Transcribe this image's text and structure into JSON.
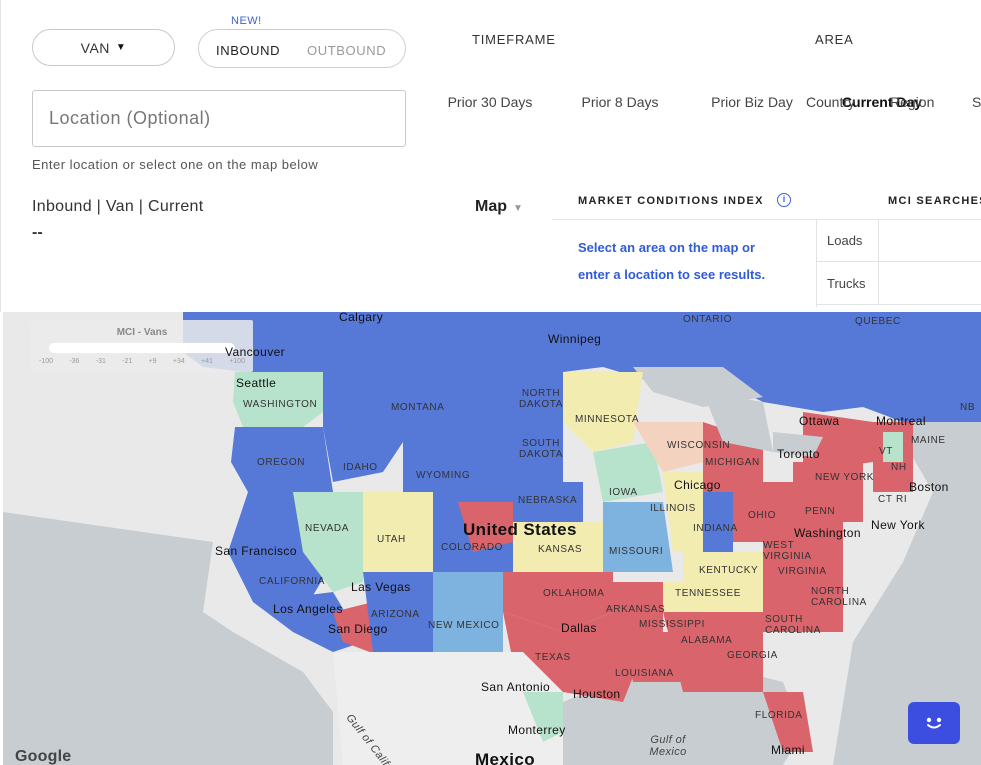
{
  "equipment": {
    "selected": "VAN",
    "caret": "▼"
  },
  "direction": {
    "badge": "NEW!",
    "options": [
      "INBOUND",
      "OUTBOUND"
    ],
    "selected": "INBOUND"
  },
  "location": {
    "placeholder": "Location (Optional)",
    "value": "",
    "helper": "Enter location or select one on the map below"
  },
  "timeframe": {
    "heading": "TIMEFRAME",
    "options": [
      "Prior 30 Days",
      "Prior 8 Days",
      "Prior Biz Day",
      "Current Day"
    ],
    "selected": "Current Day"
  },
  "area": {
    "heading": "AREA",
    "options": [
      "Country",
      "Region",
      "S"
    ]
  },
  "summary": {
    "label": "Inbound | Van | Current",
    "value": "--"
  },
  "view": {
    "selected": "Map",
    "caret": "▼"
  },
  "mci": {
    "title": "MARKET CONDITIONS INDEX",
    "info_icon": "i",
    "searches_title": "MCI SEARCHES",
    "prompt_line1": "Select an area on the map or",
    "prompt_line2": "enter a location to see results.",
    "rows": [
      {
        "label": "Loads"
      },
      {
        "label": "Trucks"
      }
    ]
  },
  "map": {
    "legend": {
      "title": "MCI - Vans",
      "ticks": [
        "-100",
        "-36",
        "-31",
        "-21",
        "+9",
        "+34",
        "+41",
        "+100"
      ]
    },
    "colors": {
      "red": "#d9646b",
      "blue": "#5678d6",
      "lightblue": "#7fb3df",
      "yellow": "#f3ecb0",
      "green": "#b7e3cc",
      "gray": "#bfbfbf",
      "land": "#e8e8e8"
    },
    "labels": {
      "calgary": "Calgary",
      "ontario": "ONTARIO",
      "quebec": "QUEBEC",
      "winnipeg": "Winnipeg",
      "vancouver": "Vancouver",
      "seattle": "Seattle",
      "washington": "WASHINGTON",
      "montana": "MONTANA",
      "north_dakota": "NORTH DAKOTA",
      "minnesota": "MINNESOTA",
      "ottawa": "Ottawa",
      "montreal": "Montreal",
      "nb": "NB",
      "maine": "MAINE",
      "vt": "VT",
      "nh": "NH",
      "oregon": "OREGON",
      "idaho": "IDAHO",
      "south_dakota": "SOUTH DAKOTA",
      "wisconsin": "WISCONSIN",
      "michigan": "MICHIGAN",
      "toronto": "Toronto",
      "new_york_state": "NEW YORK",
      "boston": "Boston",
      "wyoming": "WYOMING",
      "iowa": "IOWA",
      "chicago": "Chicago",
      "ct": "CT",
      "ri": "RI",
      "nebraska": "NEBRASKA",
      "illinois": "ILLINOIS",
      "indiana": "INDIANA",
      "ohio": "OHIO",
      "penn": "PENN",
      "new_york_city": "New York",
      "nevada": "NEVADA",
      "united_states": "United States",
      "utah": "UTAH",
      "colorado": "COLORADO",
      "kansas": "KANSAS",
      "missouri": "MISSOURI",
      "washington_dc": "Washington",
      "west_virginia": "WEST VIRGINIA",
      "san_francisco": "San Francisco",
      "kentucky": "KENTUCKY",
      "virginia": "VIRGINIA",
      "california": "CALIFORNIA",
      "las_vegas": "Las Vegas",
      "oklahoma": "OKLAHOMA",
      "tennessee": "TENNESSEE",
      "north_carolina": "NORTH CAROLINA",
      "los_angeles": "Los Angeles",
      "arizona": "ARIZONA",
      "arkansas": "ARKANSAS",
      "san_diego": "San Diego",
      "new_mexico": "NEW MEXICO",
      "dallas": "Dallas",
      "mississippi": "MISSISSIPPI",
      "south_carolina": "SOUTH CAROLINA",
      "alabama": "ALABAMA",
      "georgia": "GEORGIA",
      "texas": "TEXAS",
      "louisiana": "LOUISIANA",
      "san_antonio": "San Antonio",
      "houston": "Houston",
      "gulf_of_california": "Gulf of California",
      "florida": "FLORIDA",
      "monterrey": "Monterrey",
      "gulf_of_mexico": "Gulf of Mexico",
      "miami": "Miami",
      "mexico": "Mexico"
    },
    "attribution": "Google"
  }
}
